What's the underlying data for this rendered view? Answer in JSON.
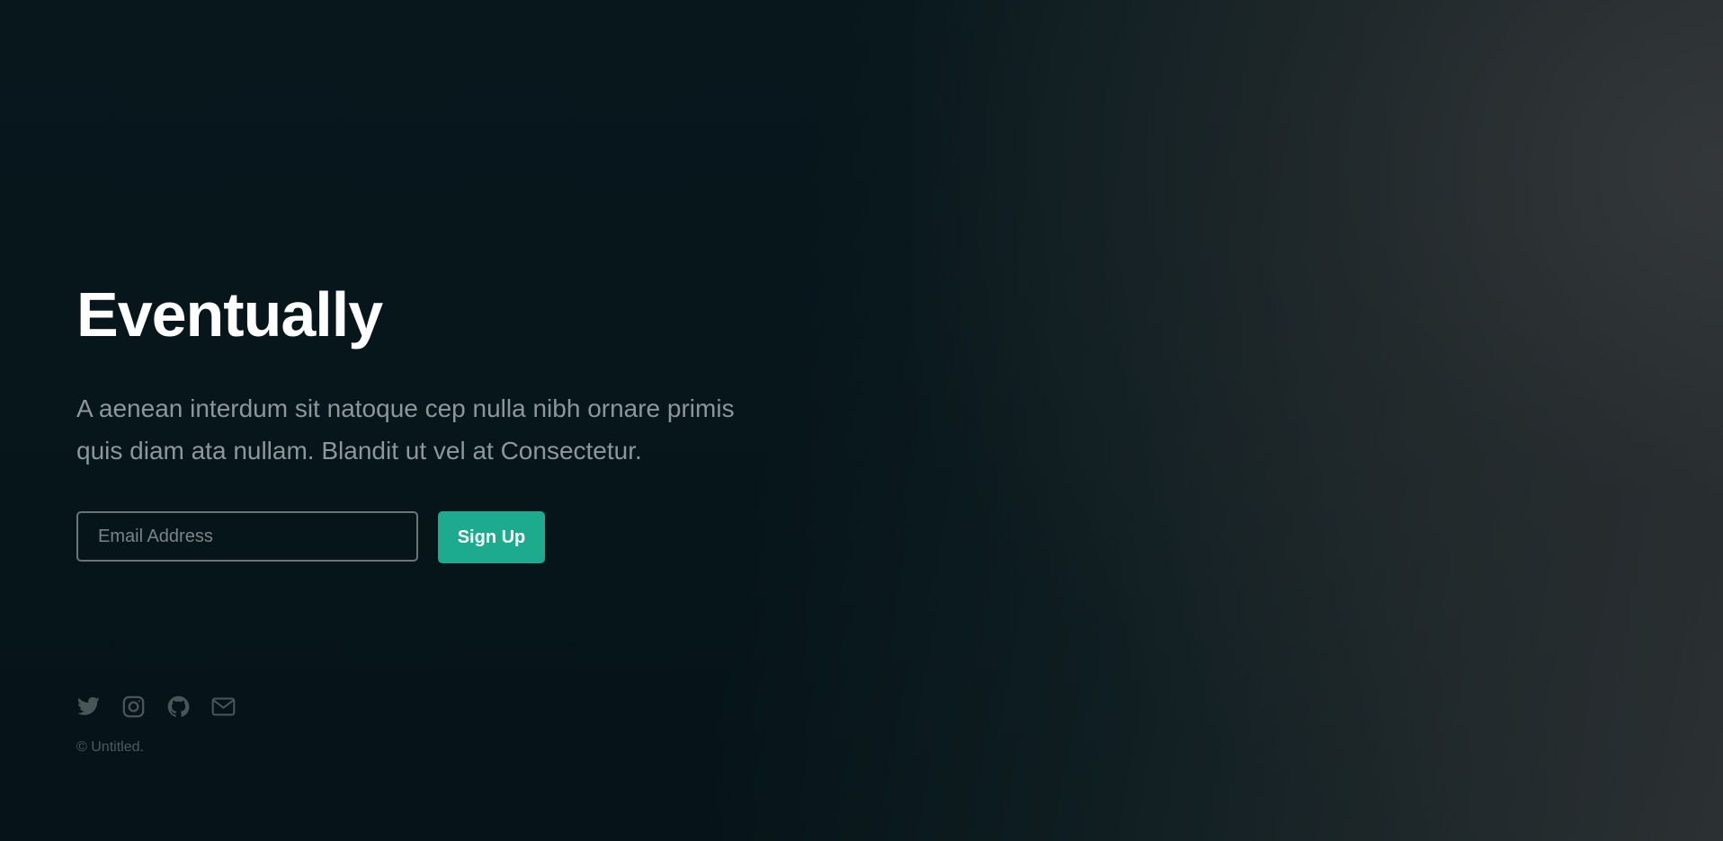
{
  "hero": {
    "title": "Eventually",
    "description": "A aenean interdum sit natoque cep nulla nibh ornare primis quis diam ata nullam. Blandit ut vel at Consectetur."
  },
  "signup": {
    "email_placeholder": "Email Address",
    "email_value": "",
    "button_label": "Sign Up"
  },
  "socials": [
    {
      "icon": "twitter-icon"
    },
    {
      "icon": "instagram-icon"
    },
    {
      "icon": "github-icon"
    },
    {
      "icon": "envelope-icon"
    }
  ],
  "footer": {
    "copyright": "© Untitled."
  },
  "colors": {
    "accent": "#1cab8f",
    "background": "#061419",
    "text_muted": "#8d979b"
  }
}
